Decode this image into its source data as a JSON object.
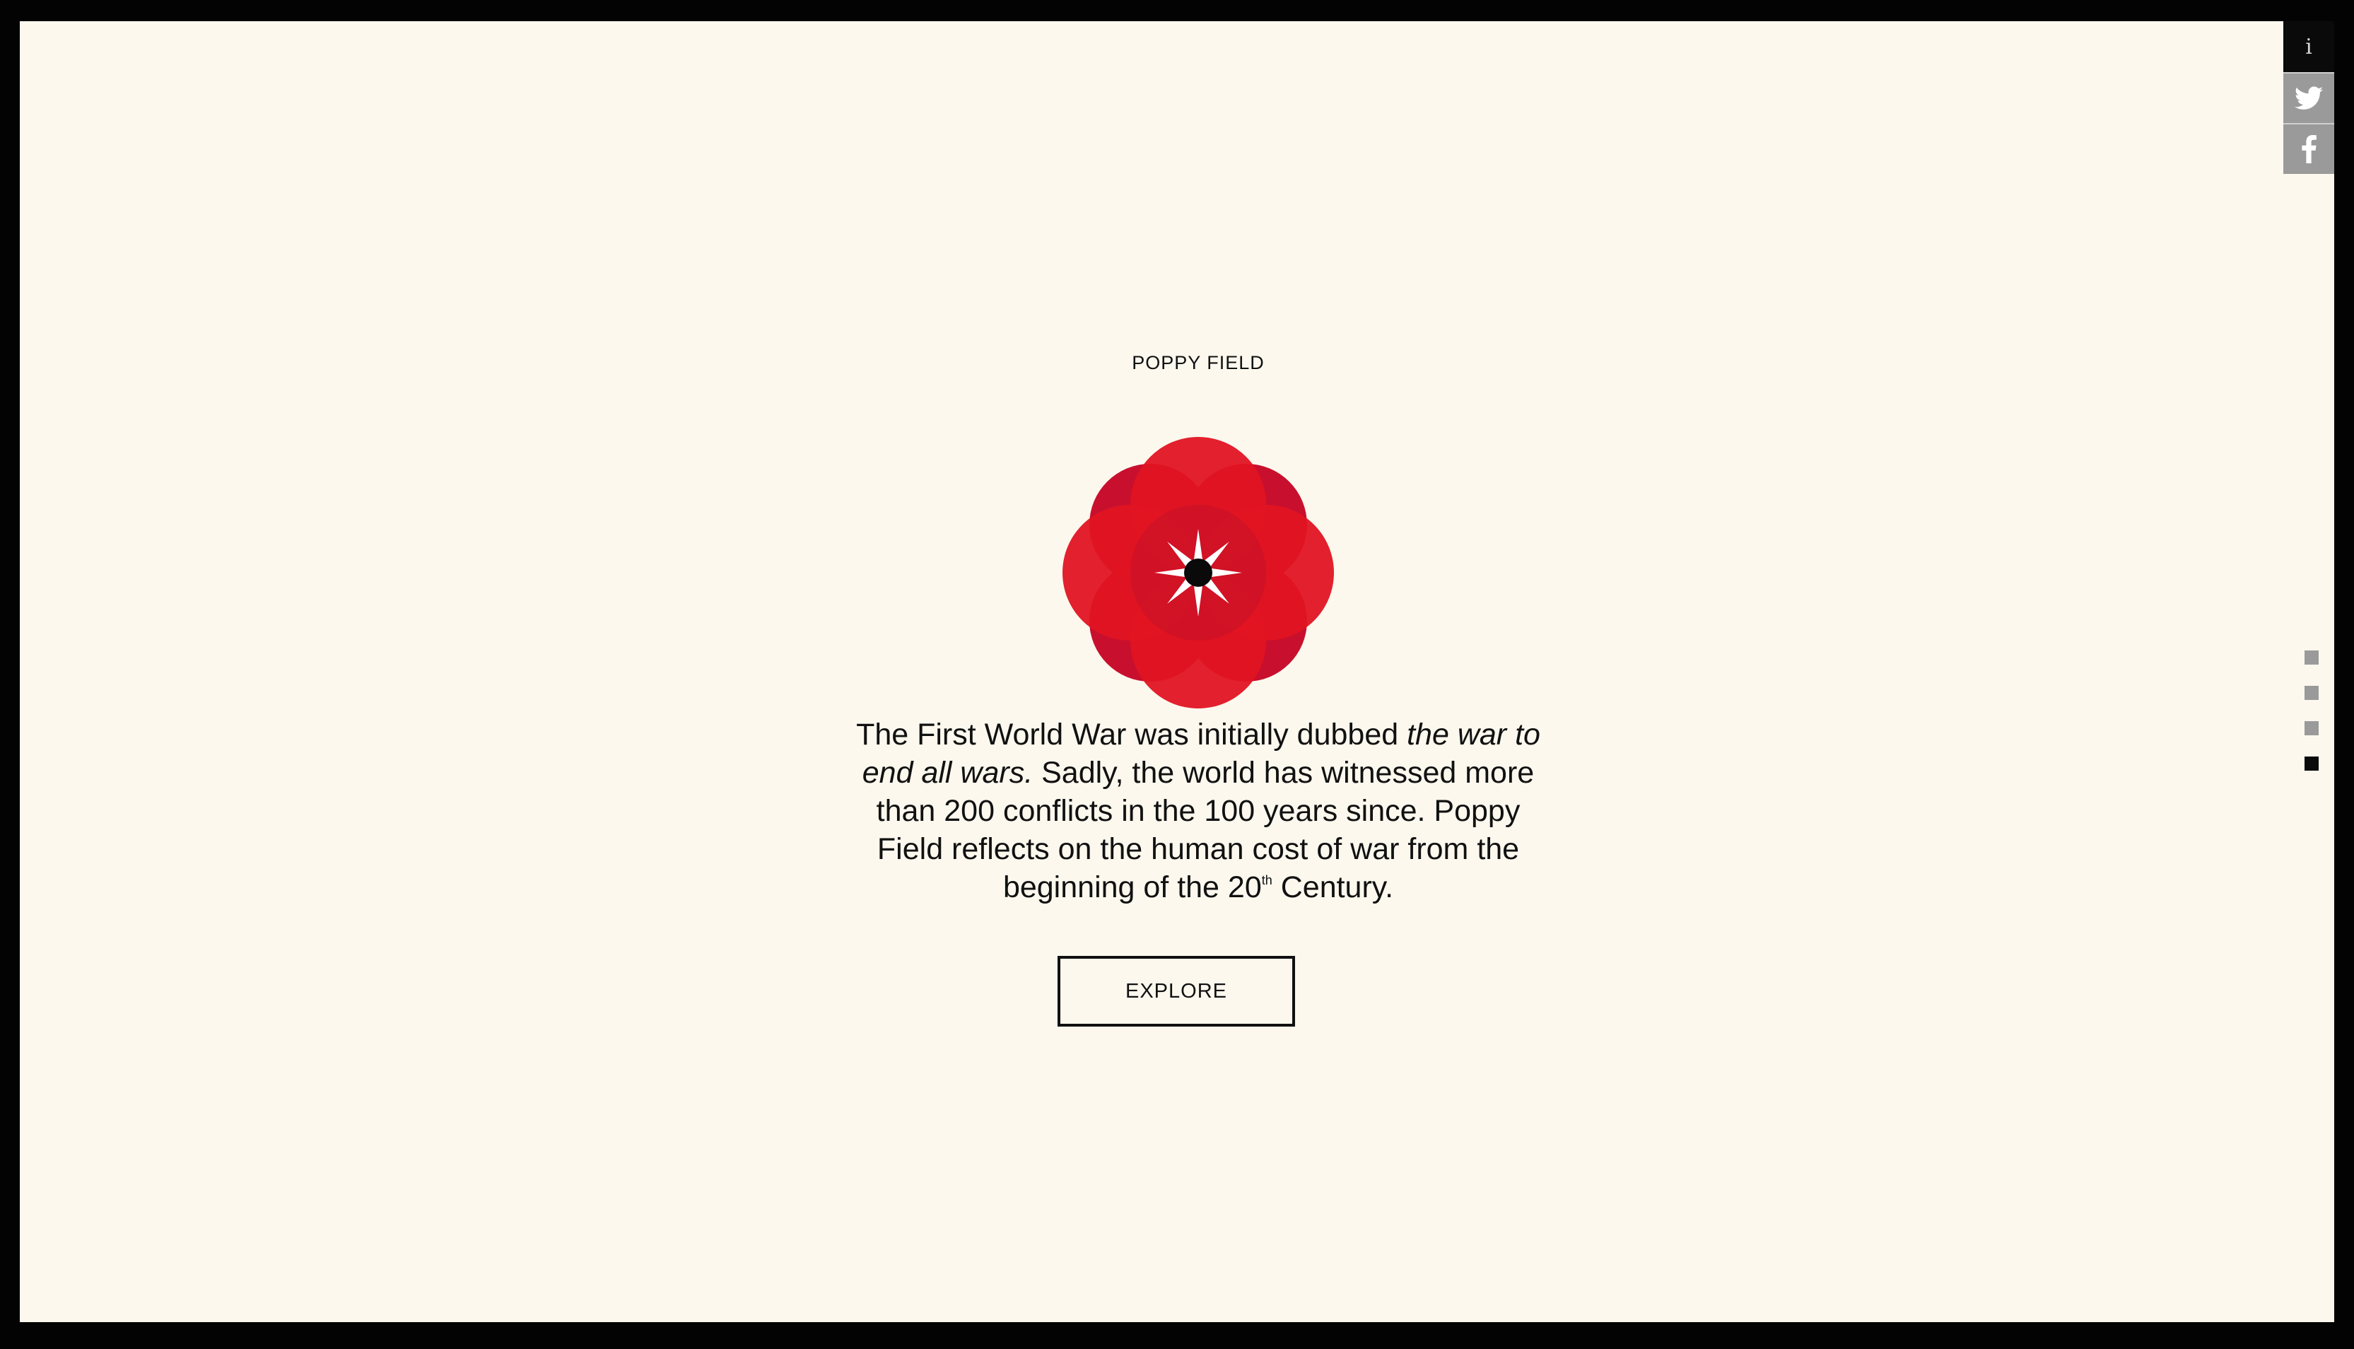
{
  "intro": {
    "title": "POPPY FIELD",
    "text_before": "The First World War was initially dubbed ",
    "text_emphasis": "the war to end all wars.",
    "text_middle": " Sadly, the world has witnessed more than 200 conflicts in the 100 years since. Poppy Field reflects on the human cost of war from the beginning of the 20",
    "text_superscript": "th",
    "text_after": " Century.",
    "explore_label": "EXPLORE"
  },
  "sidebar": {
    "info_label": "i",
    "buttons": [
      {
        "icon": "twitter-icon"
      },
      {
        "icon": "facebook-icon"
      }
    ]
  },
  "pager": {
    "count": 4,
    "active_index": 3
  },
  "colors": {
    "background": "#fcf8ee",
    "poppy_red": "#e01020",
    "poppy_dark": "#c4102a",
    "text": "#111111",
    "inactive": "#9a9a9a"
  }
}
